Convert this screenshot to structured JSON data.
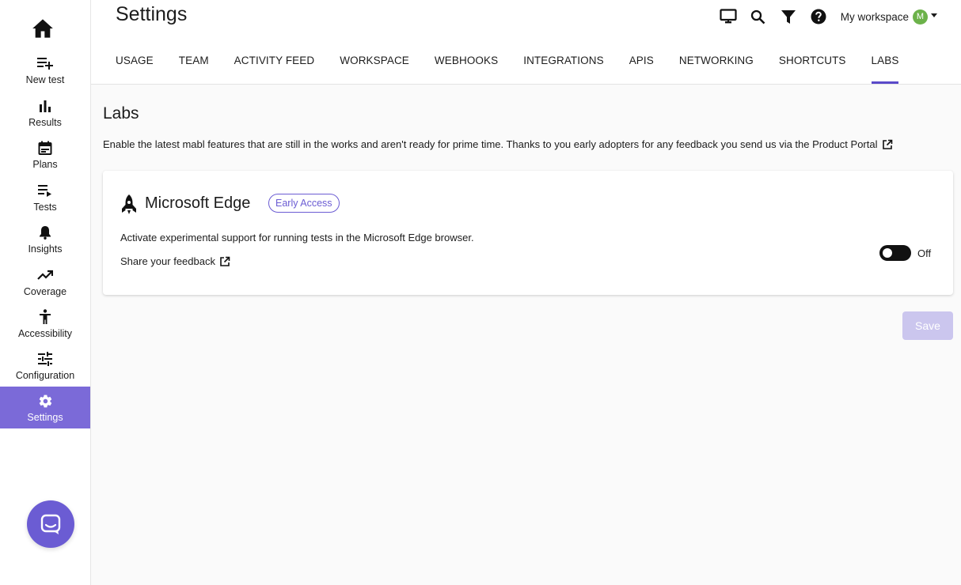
{
  "colors": {
    "accent": "#5a4ac9",
    "sidebar_active": "#7b6ad8",
    "badge": "#6b5cd3",
    "avatar": "#6cb24a",
    "save_disabled": "#cbc6ee"
  },
  "sidebar": {
    "home_icon": "home-icon",
    "items": [
      {
        "label": "New test",
        "icon": "playlist-add-icon"
      },
      {
        "label": "Results",
        "icon": "bar-chart-icon"
      },
      {
        "label": "Plans",
        "icon": "calendar-icon"
      },
      {
        "label": "Tests",
        "icon": "playlist-play-icon"
      },
      {
        "label": "Insights",
        "icon": "bell-icon"
      },
      {
        "label": "Coverage",
        "icon": "trending-up-icon"
      },
      {
        "label": "Accessibility",
        "icon": "accessibility-icon"
      },
      {
        "label": "Configuration",
        "icon": "tune-icon"
      },
      {
        "label": "Settings",
        "icon": "gear-icon",
        "active": true
      }
    ],
    "chat_icon": "chat-bubble-icon"
  },
  "header": {
    "title": "Settings",
    "icons": [
      "monitor-icon",
      "search-icon",
      "filter-icon",
      "help-icon"
    ],
    "workspace_label": "My workspace",
    "avatar_initial": "M"
  },
  "tabs": [
    {
      "label": "USAGE"
    },
    {
      "label": "TEAM"
    },
    {
      "label": "ACTIVITY FEED"
    },
    {
      "label": "WORKSPACE"
    },
    {
      "label": "WEBHOOKS"
    },
    {
      "label": "INTEGRATIONS"
    },
    {
      "label": "APIS"
    },
    {
      "label": "NETWORKING"
    },
    {
      "label": "SHORTCUTS"
    },
    {
      "label": "LABS",
      "active": true
    }
  ],
  "labs": {
    "title": "Labs",
    "description": "Enable the latest mabl features that are still in the works and aren't ready for prime time. Thanks to you early adopters for any feedback you send us via the Product Portal"
  },
  "feature": {
    "icon": "rocket-icon",
    "name": "Microsoft Edge",
    "badge": "Early Access",
    "description": "Activate experimental support for running tests in the Microsoft Edge browser.",
    "feedback_label": "Share your feedback",
    "toggle_state": "Off"
  },
  "save_label": "Save"
}
